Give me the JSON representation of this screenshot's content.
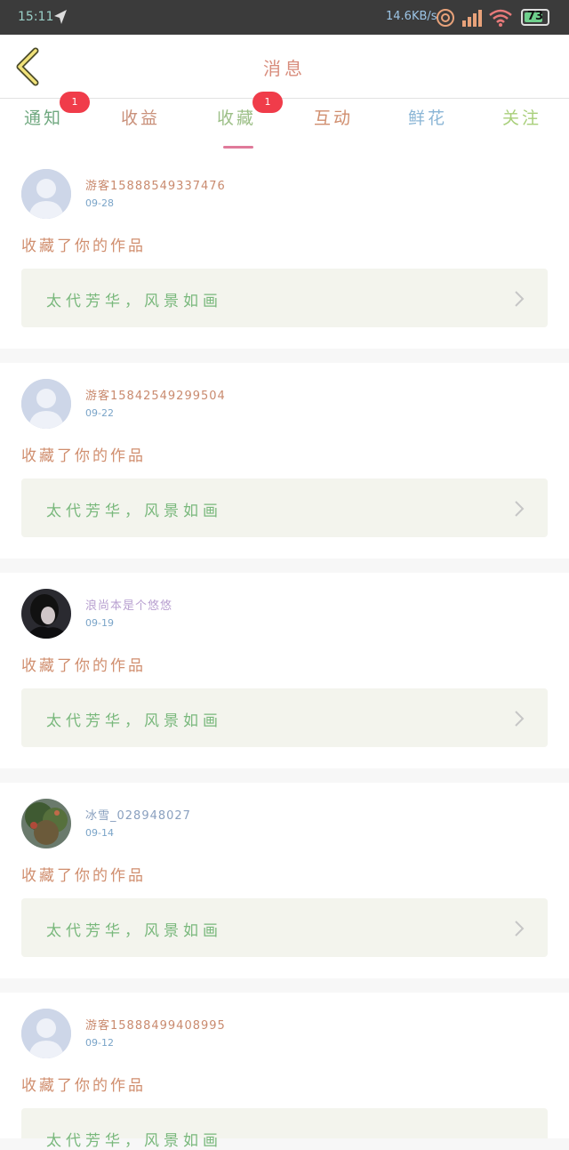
{
  "status_bar": {
    "time": "15:11",
    "net_speed": "14.6KB/s",
    "battery": "73"
  },
  "header": {
    "title": "消息"
  },
  "tabs": [
    {
      "label": "通知",
      "badge": "1",
      "color": "#6fa87f"
    },
    {
      "label": "收益",
      "badge": "",
      "color": "#c9907a"
    },
    {
      "label": "收藏",
      "badge": "1",
      "color": "#9cbf87",
      "active": true
    },
    {
      "label": "互动",
      "badge": "",
      "color": "#d08e6e"
    },
    {
      "label": "鲜花",
      "badge": "",
      "color": "#8bb6d6"
    },
    {
      "label": "关注",
      "badge": "",
      "color": "#a8cf7a"
    }
  ],
  "items": [
    {
      "name": "游客15888549337476",
      "date": "09-28",
      "action": "收藏了你的作品",
      "work": "太代芳华，风景如画",
      "avatar": "default"
    },
    {
      "name": "游客15842549299504",
      "date": "09-22",
      "action": "收藏了你的作品",
      "work": "太代芳华，风景如画",
      "avatar": "default"
    },
    {
      "name": "浪尚本是个悠悠",
      "date": "09-19",
      "action": "收藏了你的作品",
      "work": "太代芳华，风景如画",
      "avatar": "dark-portrait"
    },
    {
      "name": "冰雪_028948027",
      "date": "09-14",
      "action": "收藏了你的作品",
      "work": "太代芳华，风景如画",
      "avatar": "tree-photo"
    },
    {
      "name": "游客15888499408995",
      "date": "09-12",
      "action": "收藏了你的作品",
      "work": "太代芳华，风景如画",
      "avatar": "default"
    }
  ]
}
